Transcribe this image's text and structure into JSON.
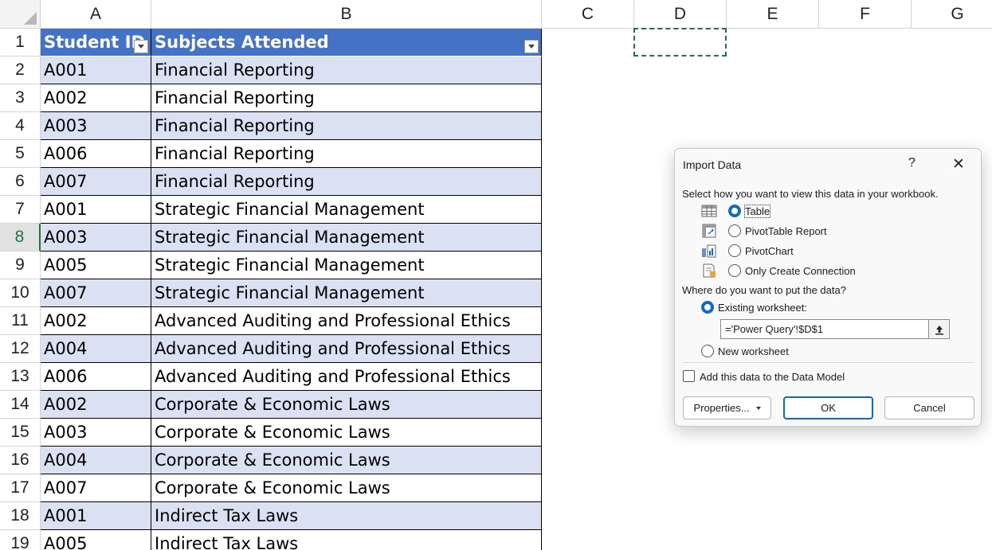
{
  "sheet": {
    "columns": [
      "A",
      "B",
      "C",
      "D",
      "E",
      "F",
      "G"
    ],
    "rows": [
      "1",
      "2",
      "3",
      "4",
      "5",
      "6",
      "7",
      "8",
      "9",
      "10",
      "11",
      "12",
      "13",
      "14",
      "15",
      "16",
      "17",
      "18",
      "19"
    ],
    "table_headers": [
      "Student ID",
      "Subjects Attended"
    ],
    "table_rows": [
      [
        "A001",
        "Financial Reporting"
      ],
      [
        "A002",
        "Financial Reporting"
      ],
      [
        "A003",
        "Financial Reporting"
      ],
      [
        "A006",
        "Financial Reporting"
      ],
      [
        "A007",
        "Financial Reporting"
      ],
      [
        "A001",
        "Strategic Financial Management"
      ],
      [
        "A003",
        "Strategic Financial Management"
      ],
      [
        "A005",
        "Strategic Financial Management"
      ],
      [
        "A007",
        "Strategic Financial Management"
      ],
      [
        "A002",
        "Advanced Auditing and Professional Ethics"
      ],
      [
        "A004",
        "Advanced Auditing and Professional Ethics"
      ],
      [
        "A006",
        "Advanced Auditing and Professional Ethics"
      ],
      [
        "A002",
        "Corporate & Economic Laws"
      ],
      [
        "A003",
        "Corporate & Economic Laws"
      ],
      [
        "A004",
        "Corporate & Economic Laws"
      ],
      [
        "A007",
        "Corporate & Economic Laws"
      ],
      [
        "A001",
        "Indirect Tax Laws"
      ],
      [
        "A005",
        "Indirect Tax Laws"
      ]
    ],
    "active_row": "8",
    "header_color": "#4472c4",
    "band_color": "#d9e1f2",
    "selection_color": "#217346"
  },
  "dialog": {
    "title": "Import Data",
    "help": "?",
    "close": "✕",
    "prompt_view": "Select how you want to view this data in your workbook.",
    "view_options": [
      {
        "label": "Table",
        "icon": "table-icon",
        "selected": true
      },
      {
        "label": "PivotTable Report",
        "icon": "pivottable-icon",
        "selected": false
      },
      {
        "label": "PivotChart",
        "icon": "pivotchart-icon",
        "selected": false
      },
      {
        "label": "Only Create Connection",
        "icon": "connection-icon",
        "selected": false
      }
    ],
    "prompt_location": "Where do you want to put the data?",
    "existing_label": "Existing worksheet:",
    "reference_value": "='Power Query'!$D$1",
    "new_label": "New worksheet",
    "data_model_label": "Add this data to the Data Model",
    "properties_label": "Properties...",
    "ok_label": "OK",
    "cancel_label": "Cancel",
    "accent": "#0f6cbd"
  }
}
